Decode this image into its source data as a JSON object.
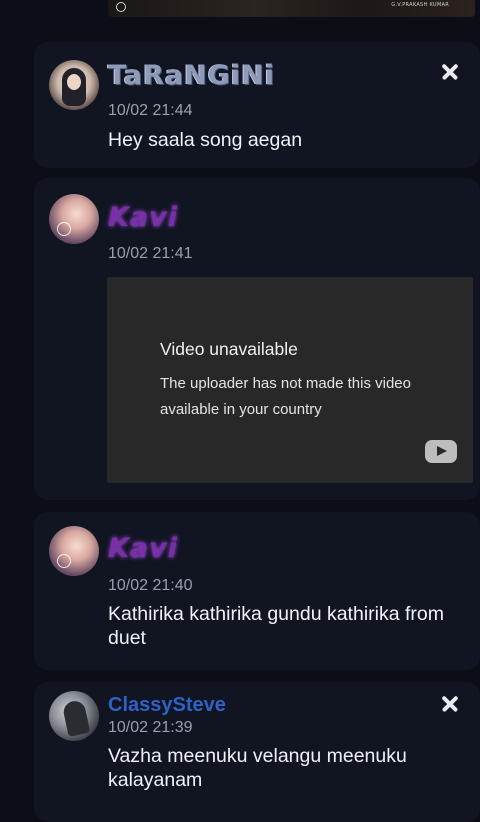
{
  "top_media": {
    "credit": "G.V.PRAKASH KUMAR"
  },
  "messages": [
    {
      "username": "TaRaNGiNi",
      "timestamp": "10/02 21:44",
      "text": "Hey saala song aegan"
    },
    {
      "username": "Kavi",
      "timestamp": "10/02 21:41",
      "video": {
        "title": "Video unavailable",
        "body": "The uploader has not made this video available in your country"
      }
    },
    {
      "username": "Kavi",
      "timestamp": "10/02 21:40",
      "text": "Kathirika kathirika gundu kathirika from duet"
    },
    {
      "username": "ClassySteve",
      "timestamp": "10/02 21:39",
      "text": "Vazha meenuku velangu meenuku kalayanam"
    }
  ],
  "icons": {
    "close": "close-icon",
    "youtube": "youtube-play-icon"
  },
  "colors": {
    "background": "#0b0e17",
    "card": "#111522",
    "steve_name": "#2f62c9",
    "kavi_name": "#7a2fa8"
  }
}
